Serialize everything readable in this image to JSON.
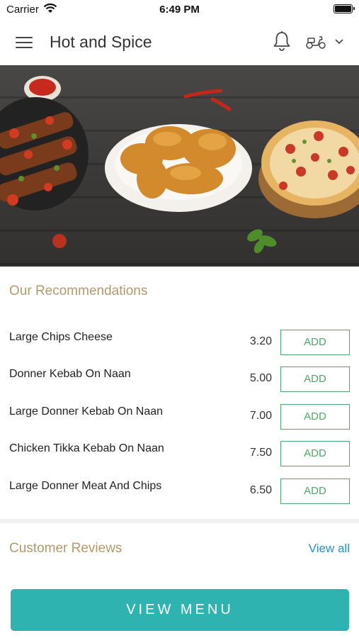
{
  "status_bar": {
    "carrier": "Carrier",
    "time": "6:49 PM"
  },
  "header": {
    "title": "Hot and Spice",
    "icons": [
      "menu-icon",
      "bell-icon",
      "scooter-icon",
      "chevron-down-icon"
    ]
  },
  "hero": {
    "image": "food-banner"
  },
  "recommendations": {
    "title": "Our Recommendations",
    "items": [
      {
        "name": "Large Chips Cheese",
        "price": "3.20",
        "add_label": "ADD"
      },
      {
        "name": "Donner Kebab On Naan",
        "price": "5.00",
        "add_label": "ADD"
      },
      {
        "name": "Large Donner Kebab On Naan",
        "price": "7.00",
        "add_label": "ADD"
      },
      {
        "name": "Chicken Tikka Kebab On Naan",
        "price": "7.50",
        "add_label": "ADD"
      },
      {
        "name": "Large Donner Meat And Chips",
        "price": "6.50",
        "add_label": "ADD"
      }
    ]
  },
  "reviews": {
    "title": "Customer Reviews",
    "view_all_label": "View all"
  },
  "footer": {
    "view_menu_label": "VIEW MENU"
  },
  "colors": {
    "accent_teal": "#2fb3b0",
    "add_green": "#4daa6a",
    "section_gold": "#b39a6c",
    "link_blue": "#2a91c6"
  }
}
